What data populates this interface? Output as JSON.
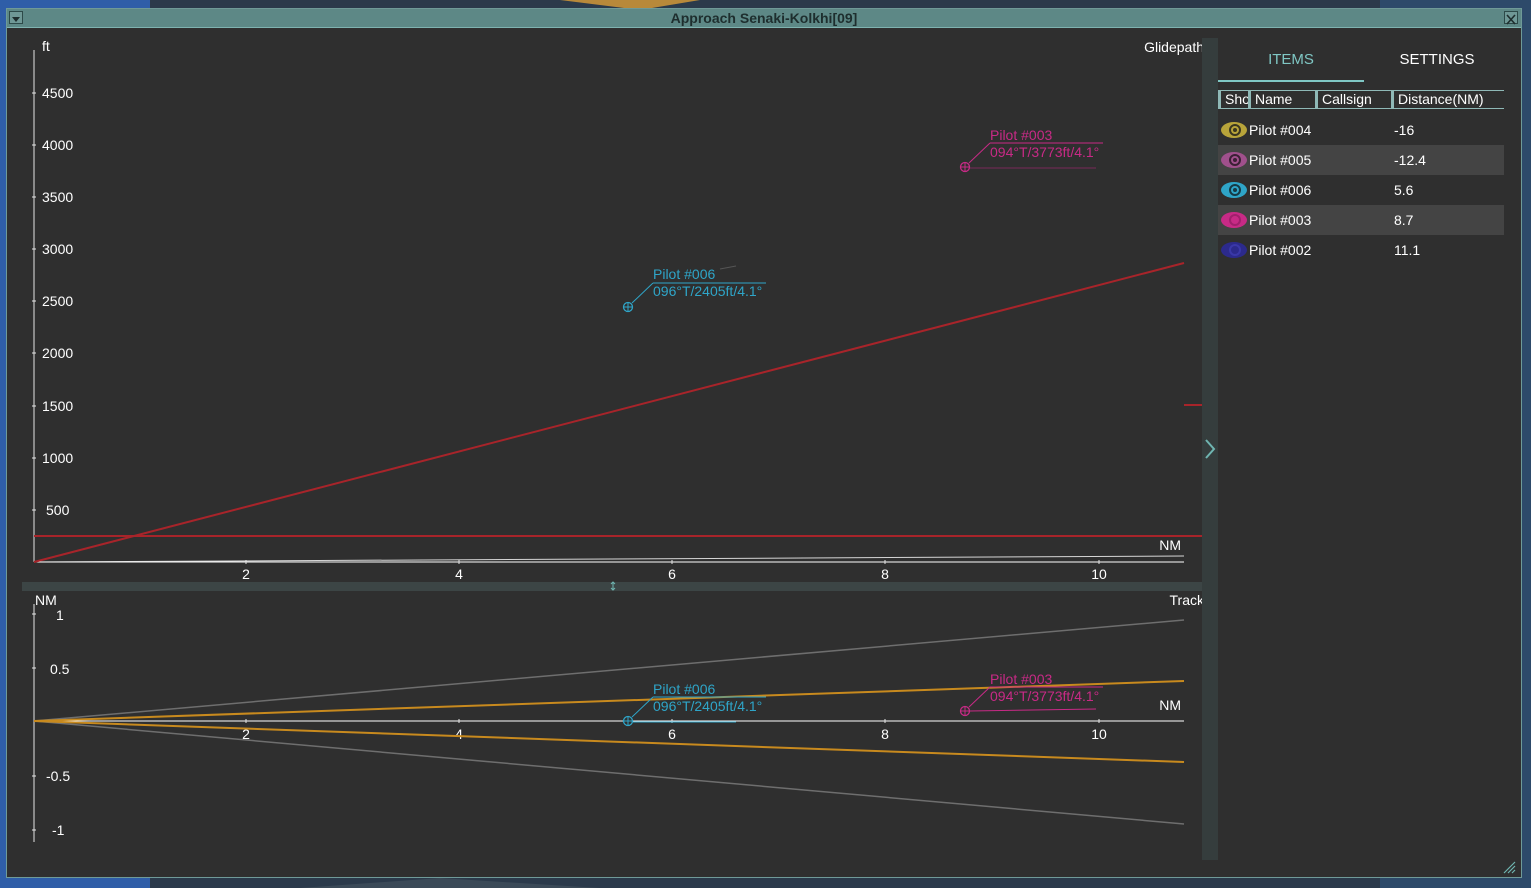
{
  "window": {
    "title": "Approach Senaki-Kolkhi[09]"
  },
  "glidepath": {
    "title": "Glidepath",
    "y_unit": "ft",
    "x_unit": "NM",
    "y_ticks": [
      "4500",
      "4000",
      "3500",
      "3000",
      "2500",
      "2000",
      "1500",
      "1000",
      "500"
    ],
    "x_ticks": [
      "2",
      "4",
      "6",
      "8",
      "10"
    ],
    "pilots": [
      {
        "name": "Pilot #006",
        "info": "096°T/2405ft/4.1°",
        "color": "#2fa5c8"
      },
      {
        "name": "Pilot #003",
        "info": "094°T/3773ft/4.1°",
        "color": "#c82a86"
      }
    ]
  },
  "track": {
    "title": "Track",
    "y_unit": "NM",
    "x_unit": "NM",
    "y_ticks": [
      "1",
      "0.5",
      "-0.5",
      "-1"
    ],
    "x_ticks": [
      "2",
      "4",
      "6",
      "8",
      "10"
    ],
    "pilots": [
      {
        "name": "Pilot #006",
        "info": "096°T/2405ft/4.1°",
        "color": "#2fa5c8"
      },
      {
        "name": "Pilot #003",
        "info": "094°T/3773ft/4.1°",
        "color": "#c82a86"
      }
    ]
  },
  "panel": {
    "tabs": {
      "items": "ITEMS",
      "settings": "SETTINGS"
    },
    "columns": {
      "show": "Show",
      "name": "Name",
      "callsign": "Callsign",
      "distance": "Distance(NM)"
    },
    "rows": [
      {
        "name": "Pilot #004",
        "callsign": "",
        "distance": "-16",
        "eye_color": "#b8a43a"
      },
      {
        "name": "Pilot #005",
        "callsign": "",
        "distance": "-12.4",
        "eye_color": "#a0508c"
      },
      {
        "name": "Pilot #006",
        "callsign": "",
        "distance": "5.6",
        "eye_color": "#2fa5c8"
      },
      {
        "name": "Pilot #003",
        "callsign": "",
        "distance": "8.7",
        "eye_color": "#c82a86"
      },
      {
        "name": "Pilot #002",
        "callsign": "",
        "distance": "11.1",
        "eye_color": "#2c2a8c"
      }
    ]
  }
}
